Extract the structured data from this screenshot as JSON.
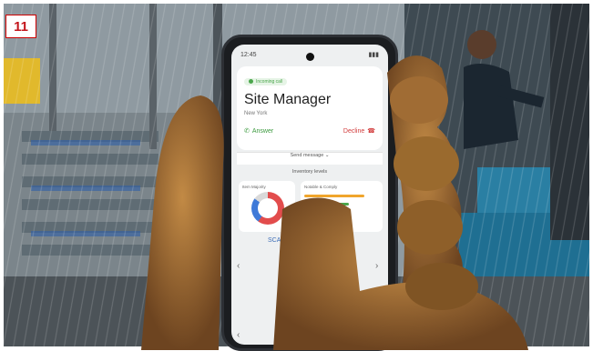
{
  "badge": {
    "number": "11"
  },
  "phone": {
    "status_time": "12:45",
    "call": {
      "status_label": "Incoming call",
      "caller_name": "Site Manager",
      "location": "New York",
      "answer_label": "Answer",
      "decline_label": "Decline"
    },
    "send_message_label": "Send message",
    "inventory_title": "Inventory levels",
    "widget_left_label": "Item Majority",
    "widget_right_label": "Notable & Comply",
    "scan_label": "SCAN"
  },
  "colors": {
    "badge_red": "#c4161c",
    "answer_green": "#3c9a3f",
    "decline_red": "#d23b3b",
    "glove_brown": "#9a6a2e"
  }
}
